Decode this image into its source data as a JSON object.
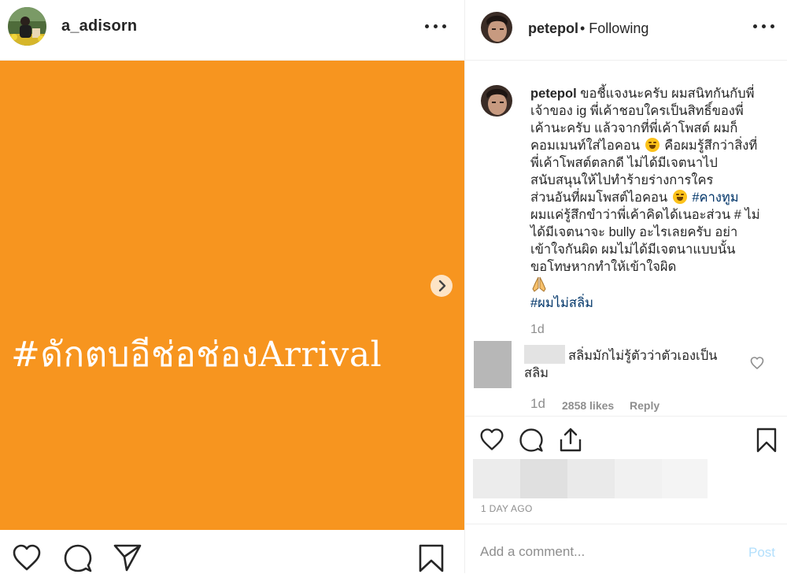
{
  "left_post": {
    "username": "a_adisorn",
    "image_text": "#ดักตบอีช่อช่องArrival",
    "image_bg_color": "#f7951f",
    "icons": {
      "more": "more-options-icon",
      "next": "chevron-right-icon",
      "like": "heart-icon",
      "comment": "comment-icon",
      "share": "paper-plane-icon",
      "save": "bookmark-icon"
    }
  },
  "right_post": {
    "header": {
      "username": "petepol",
      "follow_status": "• Following"
    },
    "caption": {
      "username": "petepol",
      "line1": "ขอชี้แจงนะครับ ผมสนิทกันกับพี่",
      "line2": "เจ้าของ ig พี่เค้าชอบใครเป็นสิทธิ์ของพี่",
      "line3": "เค้านะครับ แล้วจากที่พี่เค้าโพสต์ ผมก็",
      "line4": "คอมเมนท์ใส่ไอคอน",
      "line4b": "คือผมรู้สึกว่าสิ่งที่",
      "line5": "พี่เค้าโพสต์ตลกดี ไม่ได้มีเจตนาไป",
      "line6": "สนับสนุนให้ไปทำร้ายร่างการใคร",
      "line7": "ส่วนอันที่ผมโพสต์ไอคอน",
      "hashtag1": "#คางทูม",
      "line8": "ผมแค่รู้สึกขำว่าพี่เค้าคิดได้เนอะส่วน # ไม่",
      "line9": "ได้มีเจตนาจะ bully อะไรเลยครับ อย่า",
      "line10": "เข้าใจกันผิด ผมไม่ได้มีเจตนาแบบนั้น",
      "line11": "ขอโทษหากทำให้เข้าใจผิด",
      "hashtag2": "#ผมไม่สลิ่ม",
      "time": "1d"
    },
    "comment": {
      "line1": "สลิ่มมักไม่รู้ตัวว่าตัวเองเป็น",
      "line2": "สลิม",
      "time": "1d",
      "likes": "2858 likes",
      "reply": "Reply"
    },
    "post_time": "1 DAY AGO",
    "comment_box": {
      "placeholder": "Add a comment...",
      "post_label": "Post"
    },
    "colors": {
      "hashtag": "#003569",
      "muted": "#8e8e8e",
      "post_disabled": "#b2dffc"
    }
  }
}
